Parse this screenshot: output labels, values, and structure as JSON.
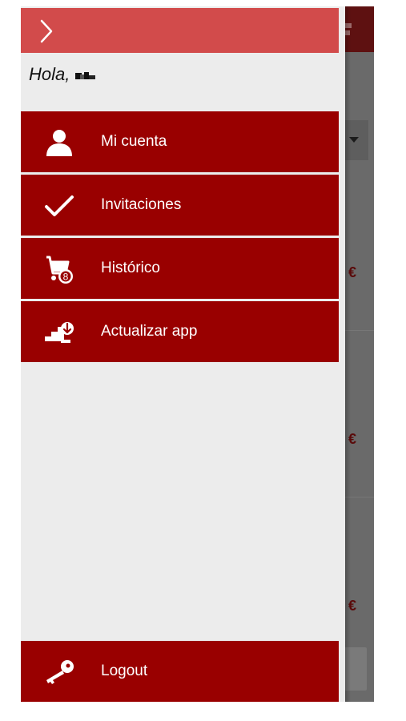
{
  "drawer": {
    "greeting": "Hola,",
    "menu_items": [
      {
        "id": "mi-cuenta",
        "label": "Mi cuenta",
        "icon": "user-icon"
      },
      {
        "id": "invitaciones",
        "label": "Invitaciones",
        "icon": "checkmark-icon"
      },
      {
        "id": "historico",
        "label": "Histórico",
        "icon": "cart-history-icon",
        "badge": "8"
      },
      {
        "id": "actualizar",
        "label": "Actualizar app",
        "icon": "stairs-update-icon"
      }
    ],
    "logout": {
      "label": "Logout",
      "icon": "key-icon"
    }
  },
  "background_app": {
    "currency_symbol": "€"
  },
  "colors": {
    "header": "#d24b4b",
    "menu_item": "#990000",
    "drawer_bg": "#ececec",
    "overlay": "#6a6a6a"
  }
}
